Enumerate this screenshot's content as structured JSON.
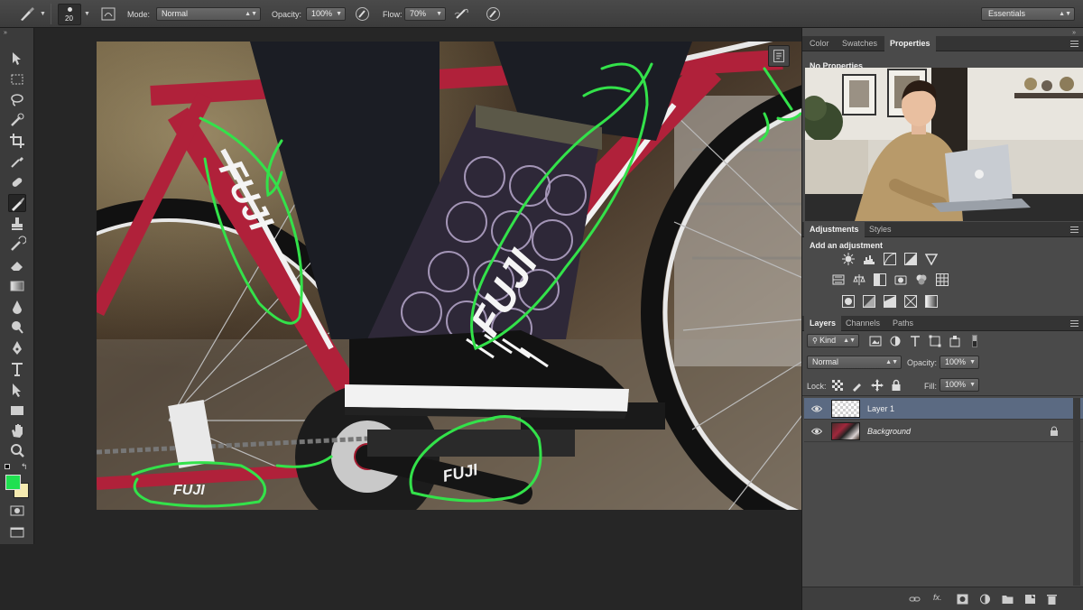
{
  "options_bar": {
    "brush_size": "20",
    "mode_label": "Mode:",
    "mode_value": "Normal",
    "opacity_label": "Opacity:",
    "opacity_value": "100%",
    "flow_label": "Flow:",
    "flow_value": "70%",
    "workspace_value": "Essentials"
  },
  "colors": {
    "foreground": "#20e050",
    "background": "#f5eab0",
    "accent": "#5b6a82",
    "stroke_green": "#33e24a"
  },
  "tools": [
    "move-tool",
    "marquee-tool",
    "lasso-tool",
    "quick-selection-tool",
    "crop-tool",
    "eyedropper-tool",
    "healing-brush-tool",
    "brush-tool",
    "clone-stamp-tool",
    "history-brush-tool",
    "eraser-tool",
    "gradient-tool",
    "blur-tool",
    "dodge-tool",
    "pen-tool",
    "type-tool",
    "path-selection-tool",
    "rectangle-tool",
    "hand-tool",
    "zoom-tool"
  ],
  "panels": {
    "top_tabs": [
      "Color",
      "Swatches",
      "Properties"
    ],
    "properties_text": "No Properties",
    "adjustments_tabs": [
      "Adjustments",
      "Styles"
    ],
    "adjustments_label": "Add an adjustment",
    "layers_tabs": [
      "Layers",
      "Channels",
      "Paths"
    ],
    "filter_kind": "Kind",
    "blend_mode": "Normal",
    "opacity_label": "Opacity:",
    "opacity_value": "100%",
    "lock_label": "Lock:",
    "fill_label": "Fill:",
    "fill_value": "100%"
  },
  "layers": [
    {
      "name": "Layer 1",
      "selected": true
    },
    {
      "name": "Background",
      "selected": false,
      "locked": true
    }
  ],
  "canvas_text": {
    "brand_top": "FUJI",
    "brand_down": "FUJI",
    "brand_crank": "FUJI",
    "brand_stay": "FUJI"
  }
}
